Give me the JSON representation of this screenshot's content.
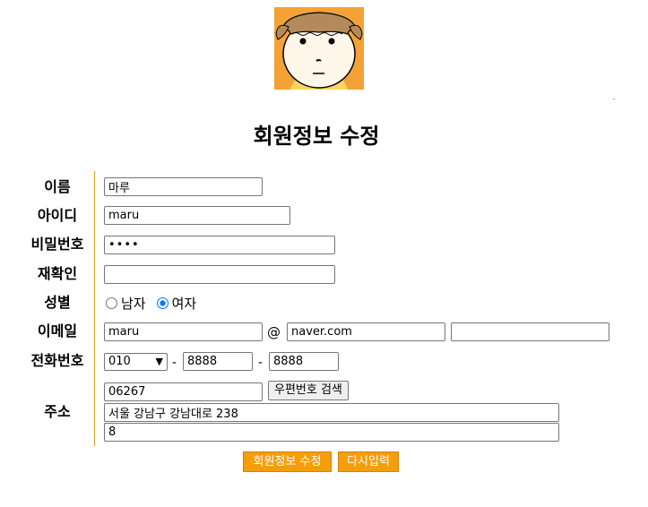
{
  "page": {
    "title": "회원정보 수정",
    "accent_color": "#f59e0b"
  },
  "avatar": {
    "icon": "cartoon-face-avatar-icon"
  },
  "form": {
    "name": {
      "label": "이름",
      "value": "마루"
    },
    "userid": {
      "label": "아이디",
      "value": "maru"
    },
    "password": {
      "label": "비밀번호",
      "value": "••••"
    },
    "password_confirm": {
      "label": "재확인",
      "value": ""
    },
    "gender": {
      "label": "성별",
      "options": [
        "남자",
        "여자"
      ],
      "selected": "여자"
    },
    "email": {
      "label": "이메일",
      "user": "maru",
      "at": "@",
      "domain": "naver.com",
      "custom": ""
    },
    "phone": {
      "label": "전화번호",
      "prefix": "010",
      "separator": "-",
      "middle": "8888",
      "last": "8888"
    },
    "address": {
      "label": "주소",
      "zipcode": "06267",
      "zip_search_label": "우편번호 검색",
      "line1": "서울 강남구 강남대로 238",
      "line2": "8"
    }
  },
  "actions": {
    "submit_label": "회원정보 수정",
    "reset_label": "다시입력"
  }
}
